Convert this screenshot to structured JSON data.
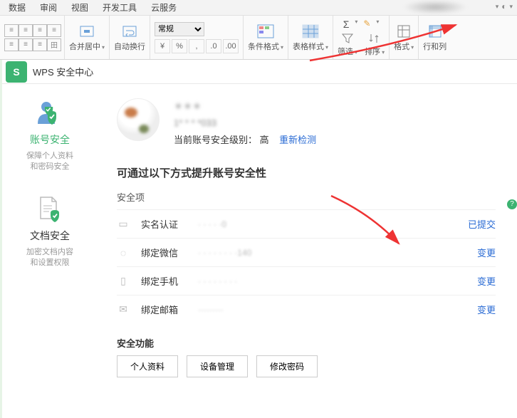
{
  "menu": {
    "items": [
      "数据",
      "审阅",
      "视图",
      "开发工具",
      "云服务"
    ]
  },
  "ribbon": {
    "merge": "合并居中",
    "wrap": "自动换行",
    "numfmt": "常规",
    "condfmt": "条件格式",
    "tblstyle": "表格样式",
    "sigma": "Σ",
    "filter": "筛选",
    "sort": "排序",
    "fmt": "格式",
    "rowcol": "行和列"
  },
  "app": {
    "logo": "S",
    "title": "WPS 安全中心"
  },
  "sidebar": {
    "items": [
      {
        "title": "账号安全",
        "desc": "保障个人资料\n和密码安全"
      },
      {
        "title": "文档安全",
        "desc": "加密文档内容\n和设置权限"
      }
    ]
  },
  "profile": {
    "name": "＊＊＊",
    "id": "1* * * *033",
    "level_label": "当前账号安全级别：",
    "level_value": "高",
    "recheck": "重新检测"
  },
  "section": {
    "heading": "可通过以下方式提升账号安全性",
    "items_label": "安全项",
    "list": [
      {
        "icon": "id",
        "name": "实名认证",
        "value": "· · · ·    ·0",
        "action": "已提交"
      },
      {
        "icon": "wechat",
        "name": "绑定微信",
        "value": "· · · · · · · ·140",
        "action": "变更"
      },
      {
        "icon": "phone",
        "name": "绑定手机",
        "value": "· · · · · · · ·",
        "action": "变更"
      },
      {
        "icon": "mail",
        "name": "绑定邮箱",
        "value": "·········",
        "action": "变更"
      }
    ],
    "func_label": "安全功能",
    "buttons": [
      "个人资料",
      "设备管理",
      "修改密码"
    ]
  }
}
